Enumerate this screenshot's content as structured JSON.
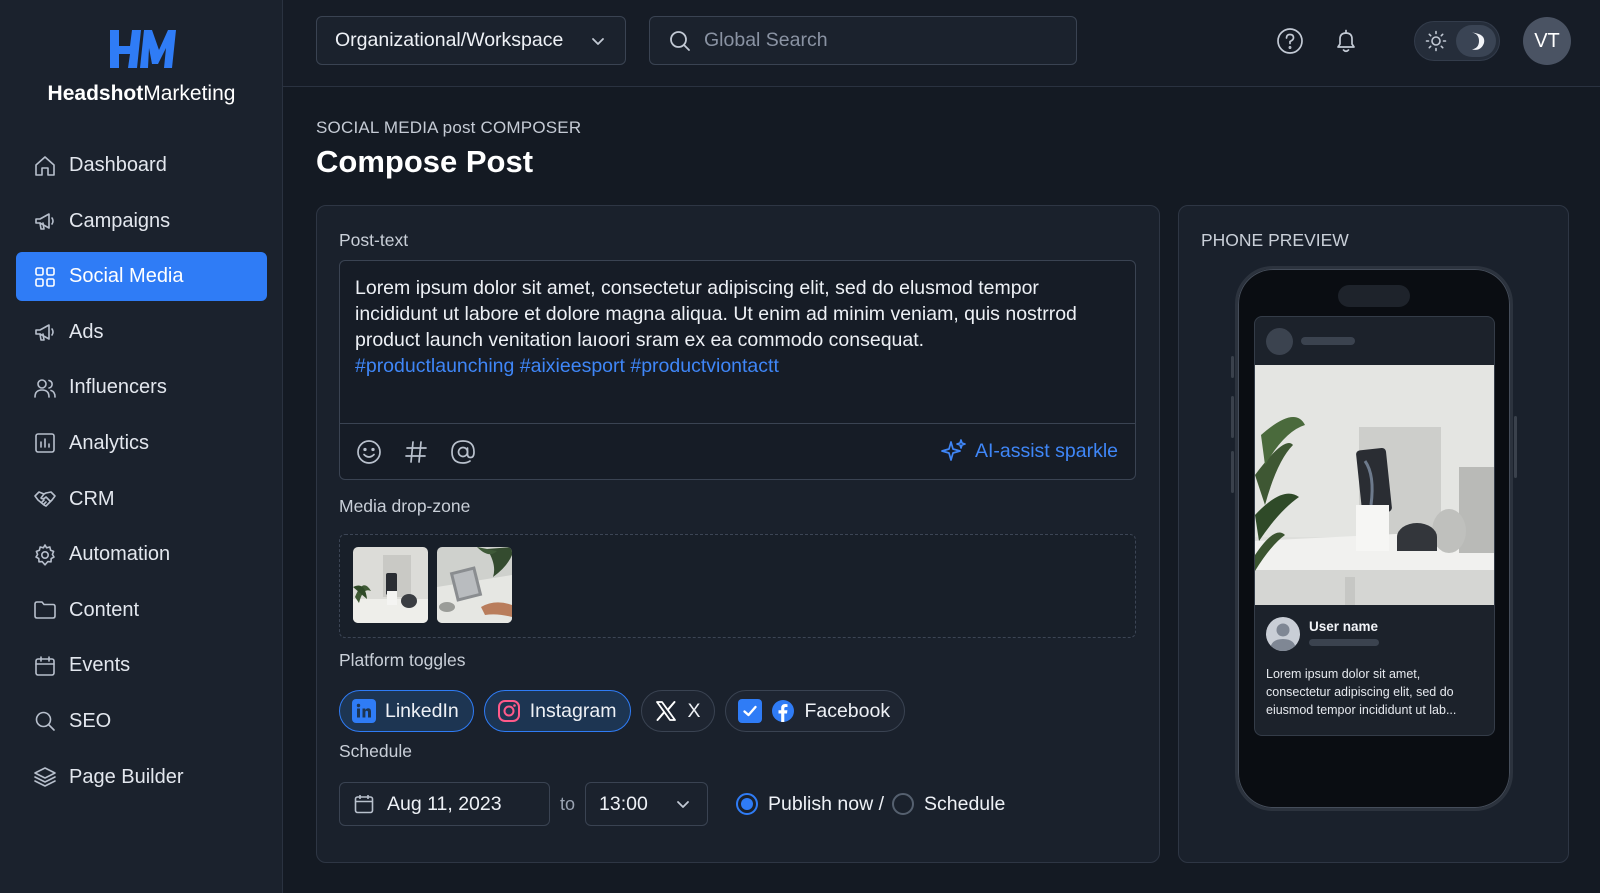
{
  "brand": {
    "bold": "Headshot",
    "regular": "Marketing"
  },
  "sidebar": {
    "items": [
      {
        "label": "Dashboard",
        "icon": "home-icon"
      },
      {
        "label": "Campaigns",
        "icon": "megaphone-icon"
      },
      {
        "label": "Social Media",
        "icon": "grid-icon",
        "active": true
      },
      {
        "label": "Ads",
        "icon": "megaphone-icon"
      },
      {
        "label": "Influencers",
        "icon": "users-icon"
      },
      {
        "label": "Analytics",
        "icon": "bar-chart-icon"
      },
      {
        "label": "CRM",
        "icon": "handshake-icon"
      },
      {
        "label": "Automation",
        "icon": "gear-icon"
      },
      {
        "label": "Content",
        "icon": "folder-icon"
      },
      {
        "label": "Events",
        "icon": "calendar-icon"
      },
      {
        "label": "SEO",
        "icon": "search-icon"
      },
      {
        "label": "Page Builder",
        "icon": "layers-icon"
      }
    ]
  },
  "topbar": {
    "workspace": "Organizational/Workspace",
    "search_placeholder": "Global Search",
    "avatar_initials": "VT"
  },
  "header": {
    "kicker": "SOCIAL MEDIA post COMPOSER",
    "title": "Compose Post"
  },
  "composer": {
    "post_text_label": "Post-text",
    "body": "Lorem ipsum dolor sit amet, consectetur adipiscing elit, sed do elusmod tempor incididunt ut labore et dolore magna aliqua. Ut enim ad minim veniam, quis nostrrod product launch venitation laıoori sram ex ea commodo consequat.",
    "hashtags": "#productlaunching #aixieesport #productviontactt",
    "ai_assist": "AI-assist sparkle",
    "media_label": "Media drop-zone",
    "platform_label": "Platform toggles",
    "platforms": [
      {
        "name": "LinkedIn",
        "selected": true
      },
      {
        "name": "Instagram",
        "selected": true
      },
      {
        "name": "X",
        "selected": false
      },
      {
        "name": "Facebook",
        "selected": false,
        "checked": true
      }
    ],
    "schedule_label": "Schedule",
    "date": "Aug 11, 2023",
    "to": "to",
    "time": "13:00",
    "publish_now": "Publish now /",
    "schedule_option": "Schedule"
  },
  "preview": {
    "label": "PHONE PREVIEW",
    "user_name": "User name",
    "caption": "Lorem ipsum dolor sit amet, consectetur adipiscing elit, sed do eiusmod tempor incididunt ut lab..."
  },
  "colors": {
    "accent": "#2f7cf6",
    "background": "#141a23",
    "sidebar": "#1b222d",
    "link": "#3f86f7"
  }
}
